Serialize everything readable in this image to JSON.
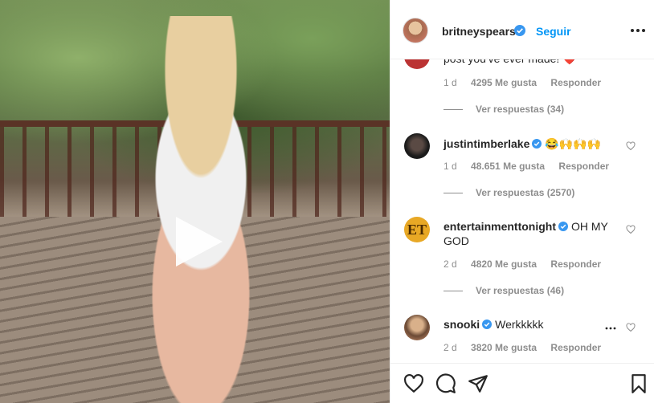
{
  "post": {
    "play_icon": "play-icon"
  },
  "header": {
    "username": "britneyspears",
    "follow_label": "Seguir",
    "verified_icon": "verified-badge-icon",
    "more_icon": "more-options-icon"
  },
  "comments": [
    {
      "username": "",
      "text": "post you've ever made! ❤️",
      "time": "1 d",
      "likes": "4295 Me gusta",
      "reply_label": "Responder",
      "view_replies": "Ver respuestas (34)"
    },
    {
      "username": "justintimberlake",
      "text": "😂🙌🙌🙌",
      "time": "1 d",
      "likes": "48.651 Me gusta",
      "reply_label": "Responder",
      "view_replies": "Ver respuestas (2570)"
    },
    {
      "username": "entertainmenttonight",
      "text": "OH MY GOD",
      "time": "2 d",
      "likes": "4820 Me gusta",
      "reply_label": "Responder",
      "view_replies": "Ver respuestas (46)"
    },
    {
      "username": "snooki",
      "text": "Werkkkkk",
      "time": "2 d",
      "likes": "3820 Me gusta",
      "reply_label": "Responder"
    }
  ],
  "actions": {
    "like_icon": "heart-icon",
    "comment_icon": "comment-icon",
    "share_icon": "share-icon",
    "save_icon": "bookmark-icon"
  },
  "colors": {
    "link": "#0095f6",
    "verified": "#3897f0",
    "muted": "#8e8e8e",
    "text": "#262626"
  }
}
